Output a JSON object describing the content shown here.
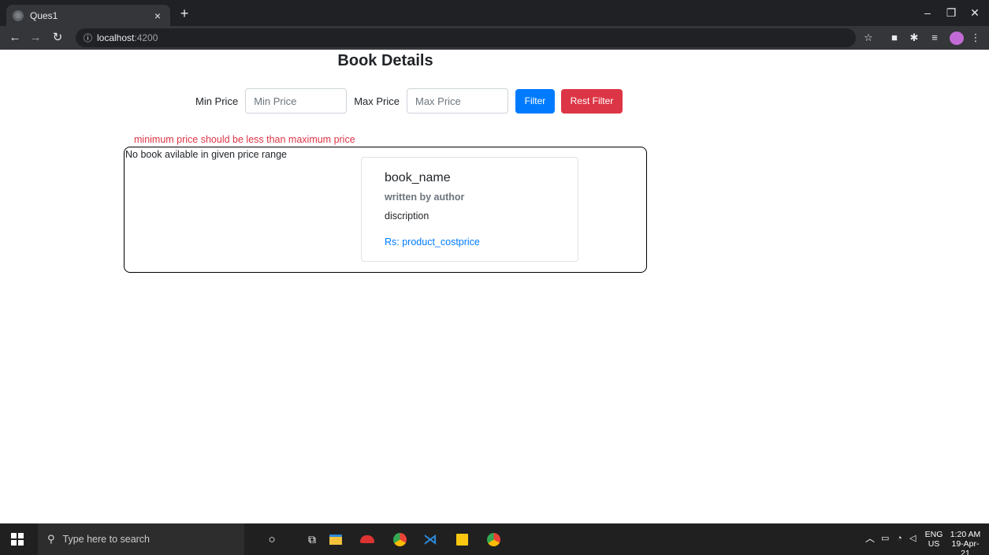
{
  "browser": {
    "tab_title": "Ques1",
    "tab_close": "×",
    "new_tab": "+",
    "url_host": "localhost",
    "url_port": ":4200",
    "window_controls": {
      "minimize": "–",
      "restore": "❐",
      "close": "✕"
    },
    "icons": [
      "back-icon",
      "forward-icon",
      "reload-icon",
      "info-icon",
      "star-icon",
      "camera-icon",
      "extensions-icon",
      "reading-list-icon",
      "profile-avatar",
      "menu-icon"
    ]
  },
  "page": {
    "title": "Book Details",
    "filter": {
      "min_label": "Min Price",
      "min_placeholder": "Min Price",
      "max_label": "Max Price",
      "max_placeholder": "Max Price",
      "filter_button": "Filter",
      "reset_button": "Rest Filter"
    },
    "error_message": "minimum price should be less than maximum price",
    "empty_message": "No book avilable in given price range",
    "card": {
      "title": "book_name",
      "author": "written by author",
      "description": "discription",
      "price": "Rs: product_costprice"
    }
  },
  "taskbar": {
    "search_placeholder": "Type here to search",
    "language": "ENG",
    "region": "US",
    "time": "1:20 AM",
    "date": "19-Apr-21"
  },
  "colors": {
    "primary": "#007bff",
    "danger": "#dc3545",
    "chrome_dark": "#202124",
    "chrome_toolbar": "#35363a",
    "taskbar": "#202020"
  }
}
